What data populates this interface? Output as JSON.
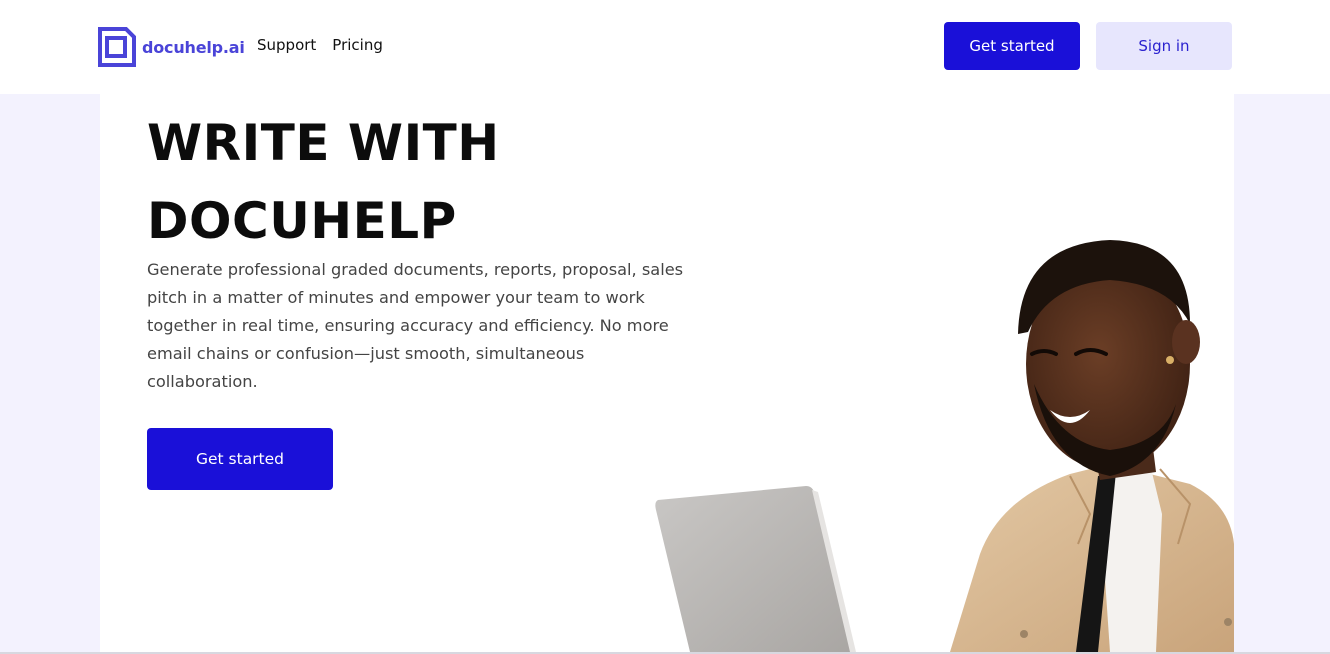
{
  "brand": {
    "name": "docuhelp.ai",
    "icon": "document-square-icon",
    "color": "#4a44d8"
  },
  "nav": {
    "links": [
      "Support",
      "Pricing"
    ]
  },
  "header_actions": {
    "get_started_label": "Get started",
    "sign_in_label": "Sign in"
  },
  "hero": {
    "title_line1": "WRITE WITH",
    "title_line2": "DOCUHELP",
    "description": "Generate professional graded documents, reports, proposal, sales pitch in a matter of minutes and empower your team to work together in real time, ensuring accuracy and efficiency. No more email chains or confusion—just smooth, simultaneous collaboration.",
    "cta_label": "Get started",
    "image": "man-smiling-with-laptop"
  },
  "colors": {
    "primary": "#1a10d8",
    "secondary_bg": "#e7e6fd",
    "page_bg": "#f3f2fe"
  }
}
